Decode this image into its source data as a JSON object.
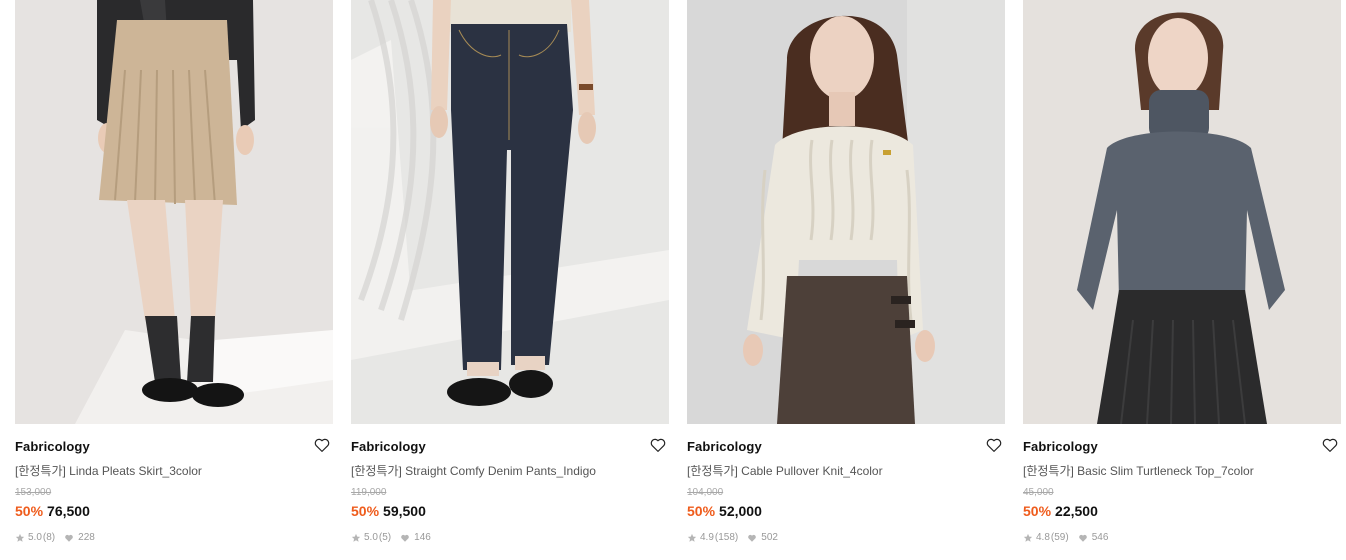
{
  "products": [
    {
      "brand": "Fabricology",
      "title": "[한정특가] Linda Pleats Skirt_3color",
      "original_price": "153,000",
      "discount": "50%",
      "price": "76,500",
      "rating": "5.0",
      "reviews": "(8)",
      "likes": "228"
    },
    {
      "brand": "Fabricology",
      "title": "[한정특가] Straight Comfy Denim Pants_Indigo",
      "original_price": "119,000",
      "discount": "50%",
      "price": "59,500",
      "rating": "5.0",
      "reviews": "(5)",
      "likes": "146"
    },
    {
      "brand": "Fabricology",
      "title": "[한정특가] Cable Pullover Knit_4color",
      "original_price": "104,000",
      "discount": "50%",
      "price": "52,000",
      "rating": "4.9",
      "reviews": "(158)",
      "likes": "502"
    },
    {
      "brand": "Fabricology",
      "title": "[한정특가] Basic Slim Turtleneck Top_7color",
      "original_price": "45,000",
      "discount": "50%",
      "price": "22,500",
      "rating": "4.8",
      "reviews": "(59)",
      "likes": "546"
    }
  ],
  "icons": {
    "wishlist": "heart-outline-icon",
    "rating": "star-icon",
    "likes": "heart-filled-icon"
  },
  "colors": {
    "discount": "#ef5c1c",
    "price": "#111111",
    "muted": "#999999"
  }
}
